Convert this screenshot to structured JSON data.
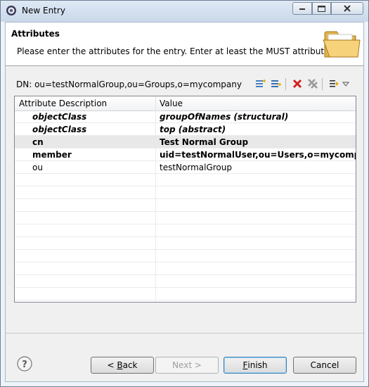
{
  "window": {
    "title": "New Entry"
  },
  "banner": {
    "title": "Attributes",
    "description": "Please enter the attributes for the entry. Enter at least the MUST attributes."
  },
  "dn": {
    "label": "DN: ou=testNormalGroup,ou=Groups,o=mycompany"
  },
  "table": {
    "headers": [
      "Attribute Description",
      "Value"
    ],
    "rows": [
      {
        "attribute": "objectClass",
        "value": "groupOfNames (structural)",
        "style": "bold-italic"
      },
      {
        "attribute": "objectClass",
        "value": "top (abstract)",
        "style": "bold-italic"
      },
      {
        "attribute": "cn",
        "value": "Test Normal Group",
        "style": "bold",
        "selected": true
      },
      {
        "attribute": "member",
        "value": "uid=testNormalUser,ou=Users,o=mycompany",
        "style": "bold"
      },
      {
        "attribute": "ou",
        "value": "testNormalGroup",
        "style": "normal"
      }
    ]
  },
  "toolbar": {
    "icons": [
      "new-attribute-icon",
      "new-value-icon",
      "delete-icon",
      "delete-all-icon",
      "sort-icon",
      "menu-dropdown-icon"
    ]
  },
  "buttons": {
    "back_prefix": "< ",
    "back_key": "B",
    "back_rest": "ack",
    "next": "Next >",
    "finish_key": "F",
    "finish_rest": "inish",
    "cancel": "Cancel"
  },
  "colors": {
    "accent": "#3c7fb1",
    "delete_red": "#d42020"
  }
}
